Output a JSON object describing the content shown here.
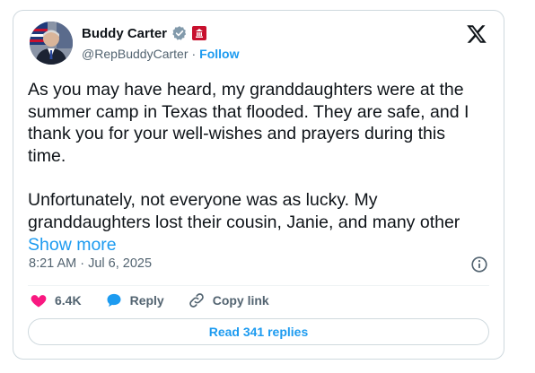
{
  "author": {
    "name": "Buddy Carter",
    "handle": "@RepBuddyCarter",
    "separator": "·",
    "follow_label": "Follow"
  },
  "icons": {
    "verified": "verified-badge-icon",
    "affiliation": "government-affiliation-icon",
    "brand": "x-logo-icon",
    "info": "info-icon",
    "like": "heart-icon",
    "reply": "speech-bubble-icon",
    "copy": "link-icon"
  },
  "colors": {
    "accent": "#1d9bf0",
    "like": "#f91880",
    "verified": "#829aab",
    "affiliation": "#c8102e"
  },
  "tweet": {
    "paragraph_1": "As you may have heard, my granddaughters were at the summer camp in Texas that flooded. They are safe, and I thank you for your well-wishes and prayers during this time.",
    "paragraph_2": "Unfortunately, not everyone was as lucky. My granddaughters lost their cousin, Janie, and many other",
    "show_more": "Show more",
    "timestamp": "8:21 AM · Jul 6, 2025"
  },
  "actions": {
    "like_count": "6.4K",
    "reply_label": "Reply",
    "copy_link_label": "Copy link"
  },
  "footer": {
    "read_replies_label": "Read 341 replies"
  }
}
